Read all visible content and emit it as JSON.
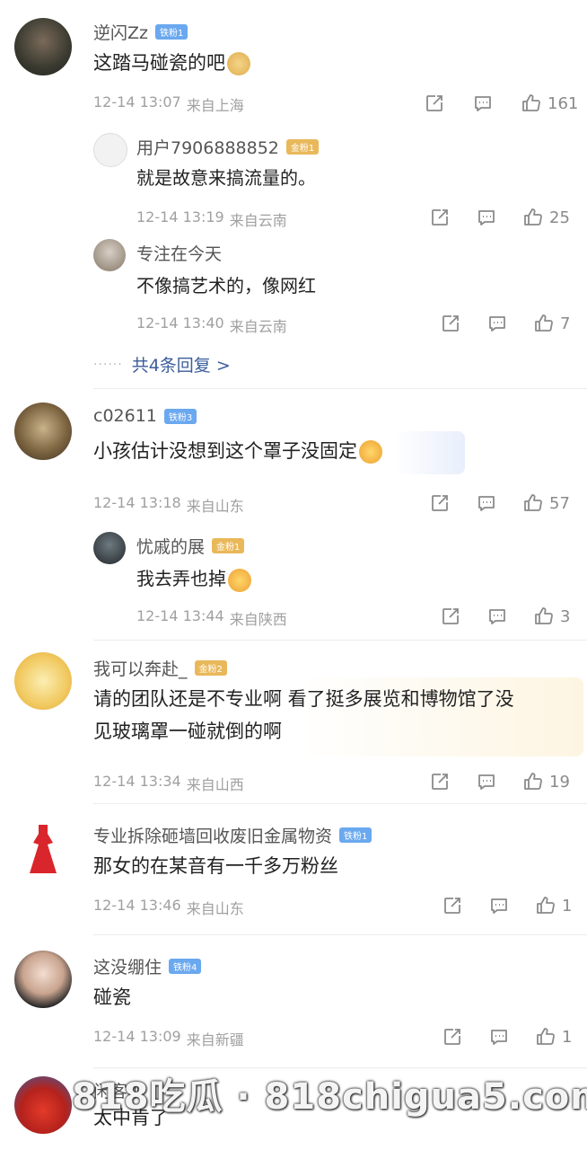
{
  "comments": [
    {
      "username": "逆闪Zz",
      "badge": "铁粉1",
      "badge_color": "blue",
      "text": "这踏马碰瓷的吧",
      "emoji": "doge-emoji",
      "date": "12-14 13:07",
      "location": "来自上海",
      "likes": "161",
      "replies": [
        {
          "username": "用户7906888852",
          "badge": "金粉1",
          "badge_color": "gold",
          "text": "就是故意来搞流量的。",
          "date": "12-14 13:19",
          "location": "来自云南",
          "likes": "25"
        },
        {
          "username": "专注在今天",
          "badge": "",
          "text": "不像搞艺术的，像网红",
          "date": "12-14 13:40",
          "location": "来自云南",
          "likes": "7"
        }
      ],
      "more_replies": "共4条回复 >"
    },
    {
      "username": "c02611",
      "badge": "铁粉3",
      "badge_color": "blue",
      "text": "小孩估计没想到这个罩子没固定",
      "emoji": "laugh-cry-emoji",
      "date": "12-14 13:18",
      "location": "来自山东",
      "likes": "57",
      "replies": [
        {
          "username": "忧戚的展",
          "badge": "金粉1",
          "badge_color": "gold",
          "text": "我去弄也掉",
          "emoji": "laugh-emoji",
          "date": "12-14 13:44",
          "location": "来自陕西",
          "likes": "3"
        }
      ]
    },
    {
      "username": "我可以奔赴_",
      "badge": "金粉2",
      "badge_color": "gold",
      "text_line1": "请的团队还是不专业啊  看了挺多展览和博物馆了没",
      "text_line2": "见玻璃罩一碰就倒的啊",
      "date": "12-14 13:34",
      "location": "来自山西",
      "likes": "19"
    },
    {
      "username": "专业拆除砸墙回收废旧金属物资",
      "badge": "铁粉1",
      "badge_color": "blue",
      "text": "那女的在某音有一千多万粉丝",
      "date": "12-14 13:46",
      "location": "来自山东",
      "likes": "1"
    },
    {
      "username": "这没绷住",
      "badge": "铁粉4",
      "badge_color": "blue",
      "text": "碰瓷",
      "date": "12-14 13:09",
      "location": "来自新疆",
      "likes": "1"
    },
    {
      "username": "闲客聊",
      "text": "太中肯了"
    }
  ],
  "watermark": "818吃瓜 · 818chigua5.com",
  "colors": {
    "link": "#3a5d9a",
    "meta": "#a0a0a0",
    "badge_blue": "#6aa8ef",
    "badge_gold": "#e9b85a"
  }
}
